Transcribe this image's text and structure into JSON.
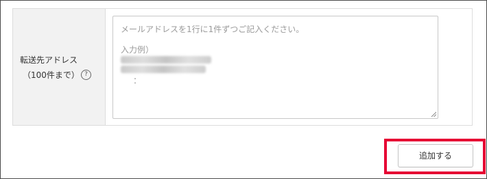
{
  "form": {
    "label_line1": "転送先アドレス",
    "label_line2": "（100件まで）",
    "help_icon": "?",
    "placeholder_line1": "メールアドレスを1行に1件ずつご記入ください。",
    "placeholder_example_label": "入力例）",
    "placeholder_continuation": "："
  },
  "actions": {
    "add_label": "追加する"
  },
  "colors": {
    "highlight": "#e60033",
    "label_bg": "#f2f2f2"
  }
}
